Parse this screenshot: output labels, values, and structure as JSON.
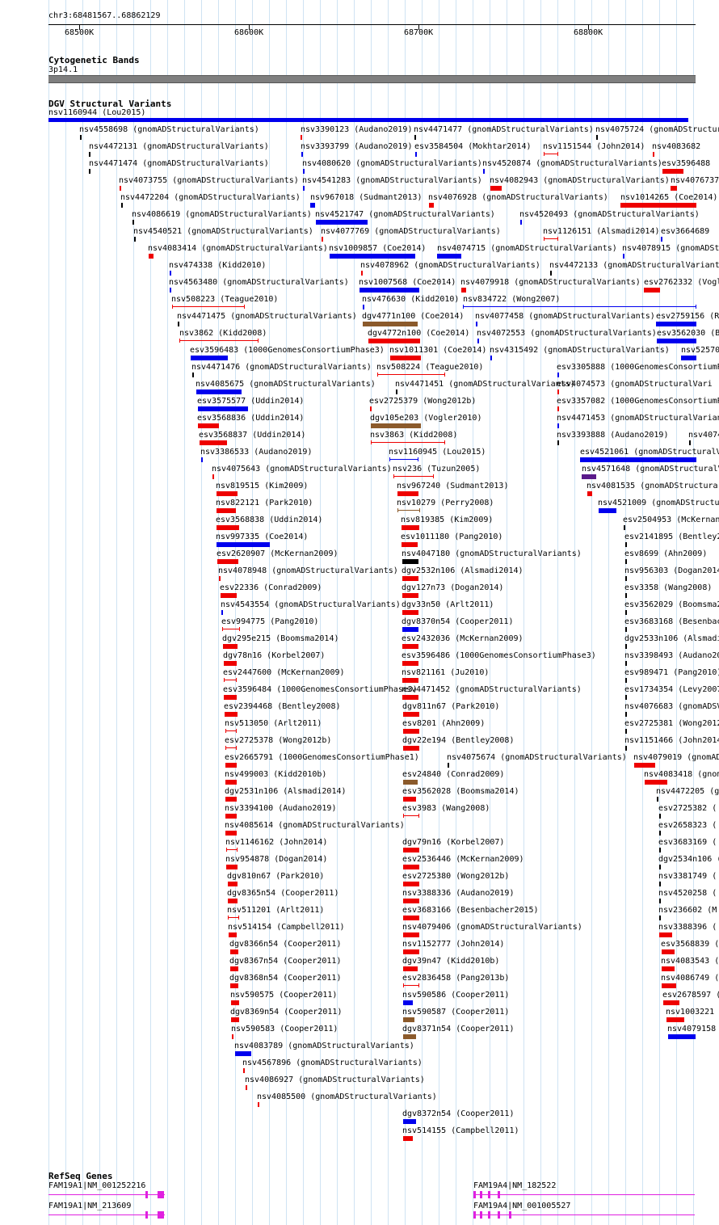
{
  "position_label": "chr3:68481567..68862129",
  "ruler": {
    "ticks": [
      {
        "label": "68500K"
      },
      {
        "label": "68600K"
      },
      {
        "label": "68700K"
      },
      {
        "label": "68800K"
      }
    ]
  },
  "cytoband": {
    "title": "Cytogenetic Bands",
    "band": "3p14.1"
  },
  "dgv": {
    "title": "DGV Structural Variants",
    "top_feature": "nsv1160944 (Lou2015)",
    "labels": [
      "nsv4558698 (gnomADStructuralVariants)",
      "nsv3390123 (Audano2019)",
      "nsv4471477 (gnomADStructuralVariants)",
      "nsv4075724 (gnomADStructuralVariants)",
      "nsv4472131 (gnomADStructuralVariants)",
      "nsv3393799 (Audano2019)",
      "esv3584504 (Mokhtar2014)",
      "nsv1151544 (John2014)",
      "nsv4083682",
      "nsv4471474 (gnomADStructuralVariants)",
      "nsv4080620 (gnomADStructuralVariants)",
      "nsv4520874 (gnomADStructuralVariants)",
      "esv3596488",
      "nsv4073755 (gnomADStructuralVariants)",
      "nsv4541283 (gnomADStructuralVariants)",
      "nsv4082943 (gnomADStructuralVariants)",
      "nsv4076737",
      "nsv4472204 (gnomADStructuralVariants)",
      "nsv967018 (Sudmant2013)",
      "nsv4076928 (gnomADStructuralVariants)",
      "nsv1014265 (Coe2014)",
      "nsv4086619 (gnomADStructuralVariants)",
      "nsv4521747 (gnomADStructuralVariants)",
      "nsv4520493 (gnomADStructuralVariants)",
      "nsv4540521 (gnomADStructuralVariants)",
      "nsv4077769 (gnomADStructuralVariants)",
      "nsv1126151 (Alsmadi2014)",
      "esv3664689",
      "nsv4083414 (gnomADStructuralVariants)",
      "nsv1009857 (Coe2014)",
      "nsv4074715 (gnomADStructuralVariants)",
      "nsv4078915 (gnomADSt",
      "nsv474338 (Kidd2010)",
      "nsv4078962 (gnomADStructuralVariants)",
      "nsv4472133 (gnomADStructuralVariants)",
      "nsv4563480 (gnomADStructuralVariants)",
      "nsv1007568 (Coe2014)",
      "nsv4079918 (gnomADStructuralVariants)",
      "esv2762332 (Vogl",
      "nsv508223 (Teague2010)",
      "nsv476630 (Kidd2010)",
      "nsv834722 (Wong2007)",
      "nsv4471475 (gnomADStructuralVariants)",
      "dgv4771n100 (Coe2014)",
      "nsv4077458 (gnomADStructuralVariants)",
      "esv2759156 (R",
      "nsv3862 (Kidd2008)",
      "dgv4772n100 (Coe2014)",
      "nsv4072553 (gnomADStructuralVariants)",
      "esv3562030 (B",
      "esv3596483 (1000GenomesConsortiumPhase3)",
      "nsv1011301 (Coe2014)",
      "nsv4315492 (gnomADStructuralVariants)",
      "nsv52570",
      "nsv4471476 (gnomADStructuralVariants)",
      "nsv508224 (Teague2010)",
      "esv3305888 (1000GenomesConsortiumP",
      "nsv4085675 (gnomADStructuralVariants)",
      "nsv4471451 (gnomADStructuralVariants)",
      "esv4074573 (gnomADStructuralVari",
      "esv3575577 (Uddin2014)",
      "esv2725379 (Wong2012b)",
      "esv3357082 (1000GenomesConsortiumP",
      "esv3568836 (Uddin2014)",
      "dgv105e203 (Vogler2010)",
      "nsv4471453 (gnomADStructuralVarian",
      "esv3568837 (Uddin2014)",
      "nsv3863 (Kidd2008)",
      "nsv3393888 (Audano2019)",
      "nsv4074",
      "nsv3386533 (Audano2019)",
      "nsv1160945 (Lou2015)",
      "esv4521061 (gnomADStructuralVari",
      "nsv4075643 (gnomADStructuralVariants)",
      "nsv236 (Tuzun2005)",
      "nsv4571648 (gnomADStructuralV",
      "nsv819515 (Kim2009)",
      "nsv967240 (Sudmant2013)",
      "nsv4081535 (gnomADStructura",
      "nsv822121 (Park2010)",
      "nsv10279 (Perry2008)",
      "nsv4521009 (gnomADStructura",
      "esv3568838 (Uddin2014)",
      "nsv819385 (Kim2009)",
      "esv2504953 (McKernan",
      "nsv997335 (Coe2014)",
      "esv1011180 (Pang2010)",
      "esv2141895 (Bentley2",
      "esv2620907 (McKernan2009)",
      "nsv4047180 (gnomADStructuralVariants)",
      "esv8699 (Ahn2009)",
      "nsv4078948 (gnomADStructuralVariants)",
      "dgv2532n106 (Alsmadi2014)",
      "nsv956303 (Dogan2014",
      "esv22336 (Conrad2009)",
      "dgv127n73 (Dogan2014)",
      "esv3358 (Wang2008)",
      "nsv4543554 (gnomADStructuralVariants)",
      "dgv33n50 (Arlt2011)",
      "esv3562029 (Boomsma2",
      "esv994775 (Pang2010)",
      "dgv8370n54 (Cooper2011)",
      "esv3683168 (Besenbac",
      "dgv295e215 (Boomsma2014)",
      "esv2432036 (McKernan2009)",
      "dgv2533n106 (Alsmadi",
      "dgv78n16 (Korbel2007)",
      "esv3596486 (1000GenomesConsortiumPhase3)",
      "nsv3398493 (Audano20",
      "esv2447600 (McKernan2009)",
      "nsv821161 (Ju2010)",
      "esv989471 (Pang2010)",
      "esv3596484 (1000GenomesConsortiumPhase3)",
      "nsv4471452 (gnomADStructuralVariants)",
      "esv1734354 (Levy2007",
      "esv2394468 (Bentley2008)",
      "dgv811n67 (Park2010)",
      "nsv4076683 (gnomADSV",
      "nsv513050 (Arlt2011)",
      "esv8201 (Ahn2009)",
      "esv2725381 (Wong2012",
      "esv2725378 (Wong2012b)",
      "dgv22e194 (Bentley2008)",
      "nsv1151466 (John2014",
      "esv2665791 (1000GenomesConsortiumPhase1)",
      "nsv4075674 (gnomADStructuralVariants)",
      "nsv4079019 (gnomAD",
      "nsv499003 (Kidd2010b)",
      "esv24840 (Conrad2009)",
      "nsv4083418 (gnom",
      "dgv2531n106 (Alsmadi2014)",
      "esv3562028 (Boomsma2014)",
      "nsv4472205 (g",
      "nsv3394100 (Audano2019)",
      "esv3983 (Wang2008)",
      "esv2725382 (",
      "nsv4085614 (gnomADStructuralVariants)",
      "esv2658323 (",
      "nsv1146162 (John2014)",
      "dgv79n16 (Korbel2007)",
      "esv3683169 (",
      "nsv954878 (Dogan2014)",
      "esv2536446 (McKernan2009)",
      "dgv2534n106 (",
      "dgv810n67 (Park2010)",
      "esv2725380 (Wong2012b)",
      "nsv3381749 (",
      "dgv8365n54 (Cooper2011)",
      "nsv3388336 (Audano2019)",
      "nsv4520258 (",
      "nsv511201 (Arlt2011)",
      "esv3683166 (Besenbacher2015)",
      "nsv236602 (M",
      "nsv514154 (Campbell2011)",
      "nsv4079406 (gnomADStructuralVariants)",
      "nsv3388396 (",
      "dgv8366n54 (Cooper2011)",
      "nsv1152777 (John2014)",
      "esv3568839 (",
      "dgv8367n54 (Cooper2011)",
      "dgv39n47 (Kidd2010b)",
      "nsv4083543 (",
      "dgv8368n54 (Cooper2011)",
      "esv2836458 (Pang2013b)",
      "nsv4086749 (",
      "nsv590575 (Cooper2011)",
      "nsv590586 (Cooper2011)",
      "esv2678597 (",
      "dgv8369n54 (Cooper2011)",
      "nsv590587 (Cooper2011)",
      "nsv1003221",
      "nsv590583 (Cooper2011)",
      "dgv8371n54 (Cooper2011)",
      "nsv4079158",
      "nsv4083789 (gnomADStructuralVariants)",
      "nsv4567896 (gnomADStructuralVariants)",
      "nsv4086927 (gnomADStructuralVariants)",
      "nsv4085500 (gnomADStructuralVariants)",
      "dgv8372n54 (Cooper2011)",
      "nsv514155 (Campbell2011)"
    ]
  },
  "refseq": {
    "title": "RefSeq Genes",
    "genes": [
      "FAM19A1|NM_001252216",
      "FAM19A1|NM_213609",
      "FAM19A4|NM_182522",
      "FAM19A4|NM_001005527"
    ]
  },
  "colors": {
    "gain": "#0000ee",
    "loss": "#ee0000",
    "inversion": "#8b5a2b",
    "complex": "#000000",
    "other": "#5a1a8a",
    "gene": "#e020e0",
    "grid": "#cfe3f3",
    "band": "#7f7f7f"
  }
}
